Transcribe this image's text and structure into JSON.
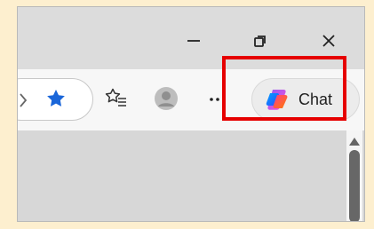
{
  "window": {
    "controls": {
      "minimize_icon": "minimize-icon",
      "restore_icon": "restore-icon",
      "close_icon": "close-icon"
    }
  },
  "toolbar": {
    "icons": {
      "address_bar_chevron": "chevron-right-icon",
      "favorite": "star-icon",
      "favorites": "favorites-icon",
      "profile": "avatar-icon",
      "more": "more-icon"
    },
    "chat_button": {
      "label": "Chat",
      "icon": "copilot-icon"
    }
  },
  "colors": {
    "highlight": "#e60000",
    "star": "#1a66d9",
    "page_background": "#fdefcf"
  }
}
